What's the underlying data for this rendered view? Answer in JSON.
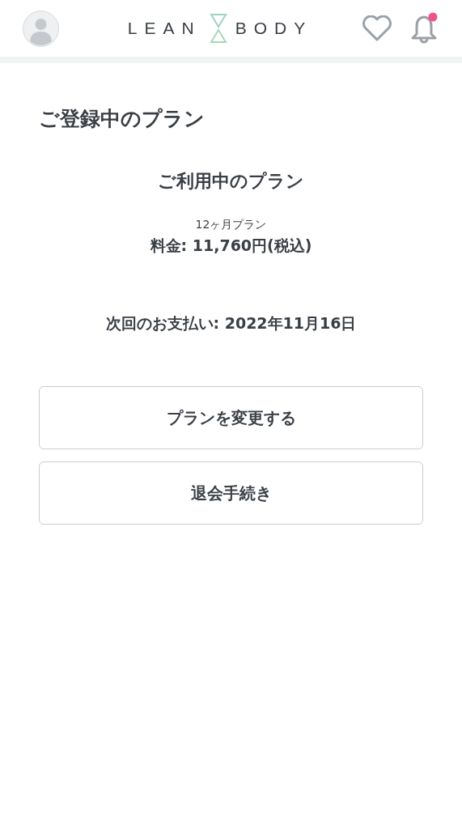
{
  "header": {
    "logo": {
      "left": "LEAN",
      "right": "BODY"
    },
    "notifications": {
      "unread": true
    }
  },
  "page_title": "ご登録中のプラン",
  "current_plan": {
    "heading": "ご利用中のプラン",
    "plan_name": "12ヶ月プラン",
    "price": "料金: 11,760円(税込)",
    "next_payment": "次回のお支払い: 2022年11月16日"
  },
  "buttons": [
    "プランを変更する",
    "退会手続き"
  ]
}
